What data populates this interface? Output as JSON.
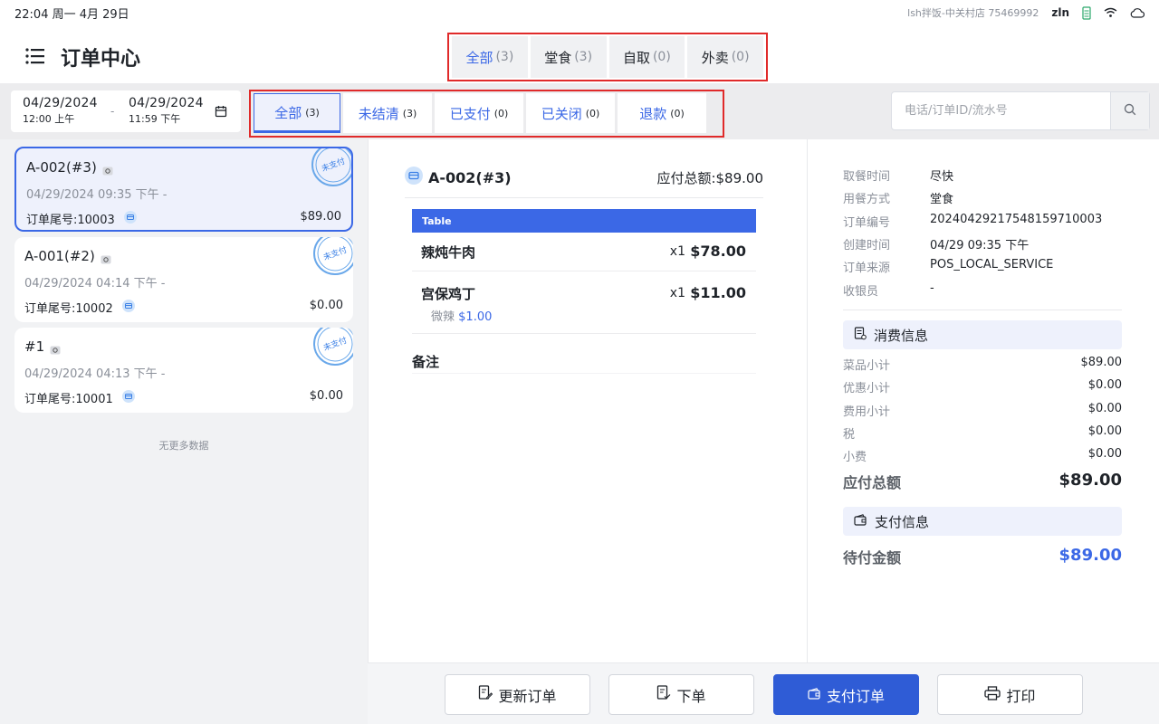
{
  "statusbar": {
    "time": "22:04 周一 4月 29日",
    "store": "lsh拌饭-中关村店  75469992",
    "user": "zln"
  },
  "header": {
    "title": "订单中心"
  },
  "type_tabs": [
    {
      "label": "全部",
      "count": "(3)"
    },
    {
      "label": "堂食",
      "count": "(3)"
    },
    {
      "label": "自取",
      "count": "(0)"
    },
    {
      "label": "外卖",
      "count": "(0)"
    }
  ],
  "date_range": {
    "start_date": "04/29/2024",
    "start_time": "12:00 上午",
    "separator": "-",
    "end_date": "04/29/2024",
    "end_time": "11:59 下午"
  },
  "status_tabs": [
    {
      "label": "全部",
      "count": "(3)"
    },
    {
      "label": "未结清",
      "count": "(3)"
    },
    {
      "label": "已支付",
      "count": "(0)"
    },
    {
      "label": "已关闭",
      "count": "(0)"
    },
    {
      "label": "退款",
      "count": "(0)"
    }
  ],
  "search": {
    "placeholder": "电话/订单ID/流水号"
  },
  "orders": [
    {
      "title": "A-002(#3)",
      "time": "04/29/2024 09:35 下午   -",
      "tail": "订单尾号:10003",
      "amount": "$89.00",
      "stamp": "未支付"
    },
    {
      "title": "A-001(#2)",
      "time": "04/29/2024 04:14 下午   -",
      "tail": "订单尾号:10002",
      "amount": "$0.00",
      "stamp": "未支付"
    },
    {
      "title": "#1",
      "time": "04/29/2024 04:13 下午   -",
      "tail": "订单尾号:10001",
      "amount": "$0.00",
      "stamp": "未支付"
    }
  ],
  "list_end": "无更多数据",
  "detail": {
    "title": "A-002(#3)",
    "due": "应付总额:$89.00",
    "table_label": "Table",
    "items": [
      {
        "name": "辣炖牛肉",
        "qty": "x1",
        "price": "$78.00"
      },
      {
        "name": "宫保鸡丁",
        "qty": "x1",
        "price": "$11.00",
        "mod_name": "微辣",
        "mod_price": "$1.00"
      }
    ],
    "remark": "备注"
  },
  "info": [
    {
      "k": "取餐时间",
      "v": "尽快"
    },
    {
      "k": "用餐方式",
      "v": "堂食"
    },
    {
      "k": "订单编号",
      "v": "20240429217548159710003"
    },
    {
      "k": "创建时间",
      "v": "04/29 09:35 下午"
    },
    {
      "k": "订单来源",
      "v": "POS_LOCAL_SERVICE"
    },
    {
      "k": "收银员",
      "v": "-"
    }
  ],
  "consume": {
    "title": "消费信息",
    "rows": [
      {
        "k": "菜品小计",
        "v": "$89.00"
      },
      {
        "k": "优惠小计",
        "v": "$0.00"
      },
      {
        "k": "费用小计",
        "v": "$0.00"
      },
      {
        "k": "税",
        "v": "$0.00"
      },
      {
        "k": "小费",
        "v": "$0.00"
      }
    ],
    "total_k": "应付总额",
    "total_v": "$89.00"
  },
  "payment": {
    "title": "支付信息",
    "pending_k": "待付金额",
    "pending_v": "$89.00"
  },
  "actions": {
    "update": "更新订单",
    "place": "下单",
    "pay": "支付订单",
    "print": "打印"
  },
  "colors": {
    "accent": "#3b68e6",
    "highlight_border": "#e02a2a"
  }
}
